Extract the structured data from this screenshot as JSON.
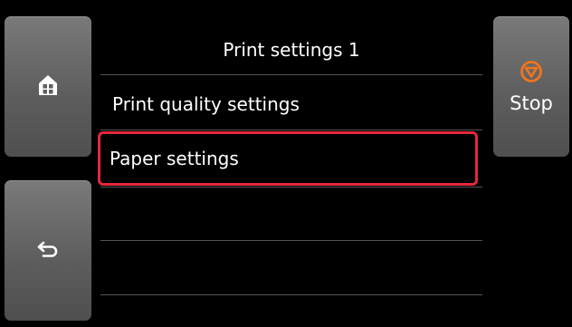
{
  "header": {
    "title": "Print settings 1"
  },
  "nav": {
    "home_icon": "home-icon",
    "back_icon": "back-arrow-icon"
  },
  "stop": {
    "label": "Stop",
    "icon": "stop-icon",
    "icon_color": "#f2741d"
  },
  "menu": {
    "items": [
      {
        "label": "Print quality settings",
        "selected": false
      },
      {
        "label": "Paper settings",
        "selected": true
      },
      {
        "label": "",
        "selected": false
      },
      {
        "label": "",
        "selected": false
      }
    ],
    "highlight_color": "#e5283a"
  }
}
